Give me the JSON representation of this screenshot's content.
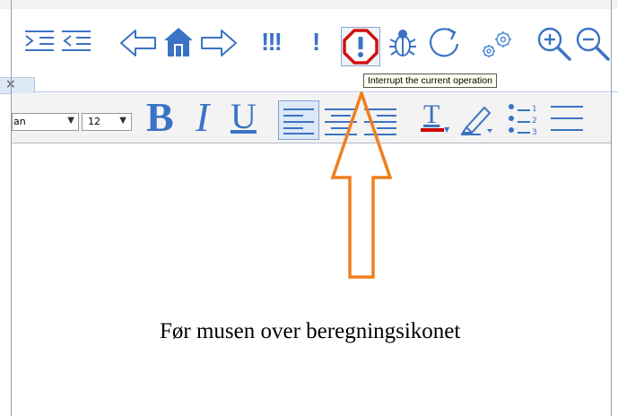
{
  "toolbar": {
    "items": [
      {
        "name": "indent-icon"
      },
      {
        "name": "outdent-icon"
      },
      {
        "name": "back-arrow-icon"
      },
      {
        "name": "home-icon"
      },
      {
        "name": "forward-arrow-icon"
      },
      {
        "name": "execute-all-icon"
      },
      {
        "name": "execute-icon"
      },
      {
        "name": "interrupt-icon"
      },
      {
        "name": "debug-bug-icon"
      },
      {
        "name": "restart-icon"
      },
      {
        "name": "settings-gears-icon"
      },
      {
        "name": "zoom-in-icon"
      },
      {
        "name": "zoom-out-icon"
      }
    ],
    "execute_all_label": "!!!",
    "execute_label": "!"
  },
  "tab": {
    "close_label": "×"
  },
  "format_bar": {
    "font_value": "an",
    "size_value": "12",
    "bold_label": "B",
    "italic_label": "I",
    "underline_label": "U",
    "text_color_label": "T",
    "highlight_color": "#cc0000"
  },
  "tooltip": {
    "text": "Interrupt the current operation"
  },
  "document": {
    "caption": "Før musen over beregningsikonet"
  },
  "colors": {
    "icon_blue": "#3b73c4",
    "interrupt_red": "#d01010",
    "arrow_orange": "#f07f1e"
  }
}
